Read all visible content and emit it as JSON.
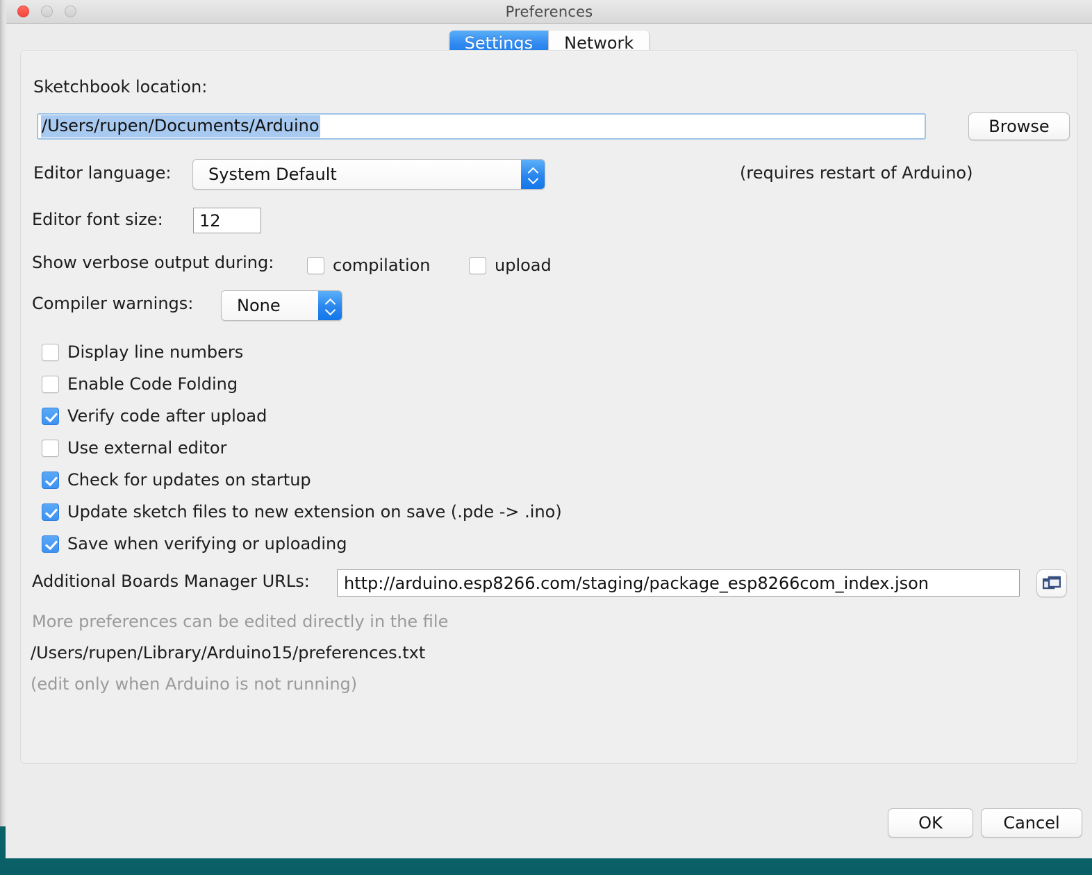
{
  "window": {
    "title": "Preferences",
    "traffic_lights": [
      "close",
      "minimize",
      "zoom"
    ]
  },
  "tabs": [
    {
      "label": "Settings",
      "active": true
    },
    {
      "label": "Network",
      "active": false
    }
  ],
  "settings": {
    "sketchbook": {
      "label": "Sketchbook location:",
      "value": "/Users/rupen/Documents/Arduino",
      "selected": true,
      "browse_label": "Browse"
    },
    "editor_language": {
      "label": "Editor language:",
      "value": "System Default",
      "note": "(requires restart of Arduino)"
    },
    "editor_font_size": {
      "label": "Editor font size:",
      "value": "12"
    },
    "verbose": {
      "label": "Show verbose output during:",
      "options": [
        {
          "label": "compilation",
          "checked": false
        },
        {
          "label": "upload",
          "checked": false
        }
      ]
    },
    "compiler_warnings": {
      "label": "Compiler warnings:",
      "value": "None"
    },
    "checkboxes": [
      {
        "label": "Display line numbers",
        "checked": false
      },
      {
        "label": "Enable Code Folding",
        "checked": false
      },
      {
        "label": "Verify code after upload",
        "checked": true
      },
      {
        "label": "Use external editor",
        "checked": false
      },
      {
        "label": "Check for updates on startup",
        "checked": true
      },
      {
        "label": "Update sketch files to new extension on save (.pde -> .ino)",
        "checked": true
      },
      {
        "label": "Save when verifying or uploading",
        "checked": true
      }
    ],
    "boards_urls": {
      "label": "Additional Boards Manager URLs:",
      "value": "http://arduino.esp8266.com/staging/package_esp8266com_index.json",
      "button_icon": "open-windows-icon"
    },
    "footer": {
      "line1": "More preferences can be edited directly in the file",
      "line2": "/Users/rupen/Library/Arduino15/preferences.txt",
      "line3": "(edit only when Arduino is not running)"
    }
  },
  "buttons": {
    "ok": "OK",
    "cancel": "Cancel"
  },
  "colors": {
    "accent_blue": "#2f88ef",
    "selection_blue": "#a8c9f0",
    "desktop_teal": "#0d7880",
    "panel_gray": "#efefef",
    "muted_text": "#9a9a9a"
  }
}
